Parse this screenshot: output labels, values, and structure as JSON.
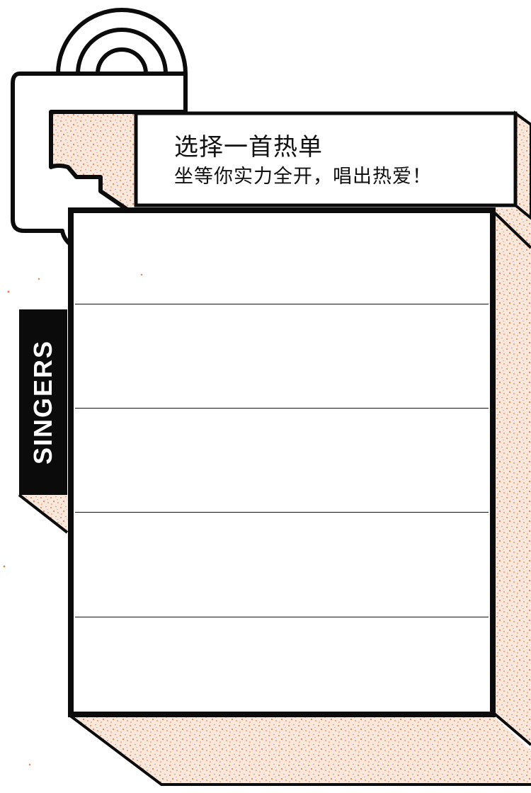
{
  "header": {
    "title": "选择一首热单",
    "subtitle": "坐等你实力全开，唱出热爱！"
  },
  "side_tab": {
    "label": "SINGERS"
  },
  "song_list": {
    "rows": [
      "",
      "",
      "",
      "",
      ""
    ]
  },
  "colors": {
    "speckle": "#e9824a",
    "stroke": "#0b0b0b",
    "panel": "#ffffff"
  }
}
